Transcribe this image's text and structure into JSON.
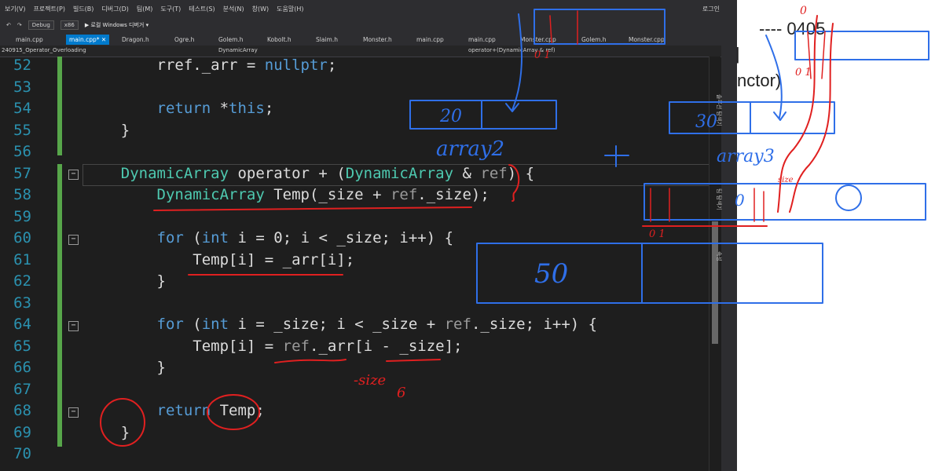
{
  "menu": {
    "items": [
      "보기(V)",
      "프로젝트(P)",
      "빌드(B)",
      "디버그(D)",
      "팀(M)",
      "도구(T)",
      "테스트(S)",
      "분석(N)",
      "창(W)",
      "도움말(H)"
    ],
    "login": "로그인"
  },
  "toolbar": {
    "config": "Debug",
    "platform": "x86",
    "run": "▶ 로컬 Windows 디버거 ▾"
  },
  "tabs": [
    {
      "label": "main.cpp",
      "active": false
    },
    {
      "label": "main.cpp* ✕",
      "active": true
    },
    {
      "label": "Dragon.h",
      "active": false
    },
    {
      "label": "Ogre.h",
      "active": false
    },
    {
      "label": "Golem.h",
      "active": false
    },
    {
      "label": "Kobolt.h",
      "active": false
    },
    {
      "label": "Slaim.h",
      "active": false
    },
    {
      "label": "Monster.h",
      "active": false
    },
    {
      "label": "main.cpp",
      "active": false
    },
    {
      "label": "main.cpp",
      "active": false
    },
    {
      "label": "Monster.cpp",
      "active": false
    },
    {
      "label": "Golem.h",
      "active": false
    },
    {
      "label": "Monster.cpp",
      "active": false
    }
  ],
  "navbar": {
    "project": "240915_Operator_Overloading",
    "scope": "DynamicArray",
    "member": "operator+(DynamicArray & ref)"
  },
  "editor": {
    "lines": [
      {
        "n": "52",
        "html": "        rref._arr = nullptr;"
      },
      {
        "n": "53",
        "html": ""
      },
      {
        "n": "54",
        "html": "        return *this;"
      },
      {
        "n": "55",
        "html": "    }"
      },
      {
        "n": "56",
        "html": ""
      },
      {
        "n": "57",
        "html": "    DynamicArray operator + (DynamicArray & ref) {"
      },
      {
        "n": "58",
        "html": "        DynamicArray Temp(_size + ref._size);"
      },
      {
        "n": "59",
        "html": ""
      },
      {
        "n": "60",
        "html": "        for (int i = 0; i < _size; i++) {"
      },
      {
        "n": "61",
        "html": "            Temp[i] = _arr[i];"
      },
      {
        "n": "62",
        "html": "        }"
      },
      {
        "n": "63",
        "html": ""
      },
      {
        "n": "64",
        "html": "        for (int i = _size; i < _size + ref._size; i++) {"
      },
      {
        "n": "65",
        "html": "            Temp[i] = ref._arr[i - _size];"
      },
      {
        "n": "66",
        "html": "        }"
      },
      {
        "n": "67",
        "html": ""
      },
      {
        "n": "68",
        "html": "        return Temp;"
      },
      {
        "n": "69",
        "html": "    }"
      },
      {
        "n": "70",
        "html": ""
      }
    ]
  },
  "doc": {
    "heading_fragment": "---- 0405",
    "frag2": "|",
    "frag3": "nctor)"
  },
  "annotations": {
    "array2_label": "array2",
    "array3_label": "array3",
    "plus": "+",
    "box1_value": "20",
    "box2_value": "30",
    "box3_value": "50",
    "size_note": "-size",
    "six": "6",
    "zero": "0",
    "idx01_a": "0 1",
    "idx01_b": "0 1",
    "idx01_c": "0 1",
    "size_small": "size",
    "zero_b": "0"
  },
  "colors": {
    "blue_ink": "#2f6fe8",
    "red_ink": "#e02020",
    "accent": "#007acc"
  }
}
